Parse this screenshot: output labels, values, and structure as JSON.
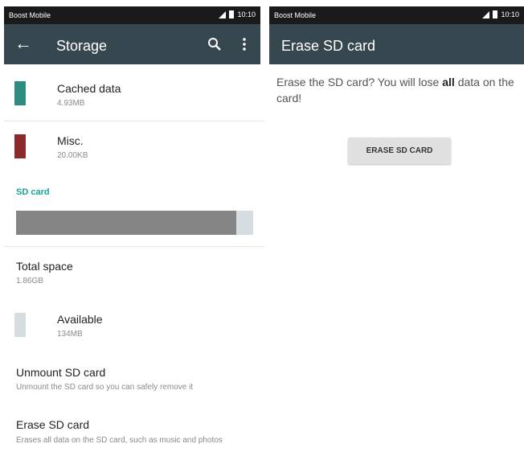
{
  "colors": {
    "toolbar": "#37474f",
    "accent": "#14a49a",
    "cached_swatch": "#2e8b80",
    "misc_swatch": "#8b2a2a",
    "available_swatch": "#d6dde0",
    "used_bar": "#858585"
  },
  "left_screen": {
    "status_bar": {
      "carrier": "Boost Mobile",
      "time": "10:10"
    },
    "app_bar": {
      "title": "Storage",
      "back_icon": "arrow-back-icon",
      "search_icon": "search-icon",
      "overflow_icon": "more-vert-icon"
    },
    "items": [
      {
        "label": "Cached data",
        "value": "4.93MB"
      },
      {
        "label": "Misc.",
        "value": "20.00KB"
      }
    ],
    "sd_section": {
      "header": "SD card",
      "used_fraction": 0.93,
      "total_label": "Total space",
      "total_value": "1.86GB",
      "available_label": "Available",
      "available_value": "134MB"
    },
    "actions": [
      {
        "label": "Unmount SD card",
        "summary": "Unmount the SD card so you can safely remove it"
      },
      {
        "label": "Erase SD card",
        "summary": "Erases all data on the SD card, such as music and photos"
      }
    ]
  },
  "right_screen": {
    "status_bar": {
      "carrier": "Boost Mobile",
      "time": "10:10"
    },
    "app_bar": {
      "title": "Erase SD card"
    },
    "message_part1": "Erase the SD card? You will lose ",
    "message_bold": "all",
    "message_part2": " data on the card!",
    "erase_button_label": "ERASE SD CARD"
  }
}
